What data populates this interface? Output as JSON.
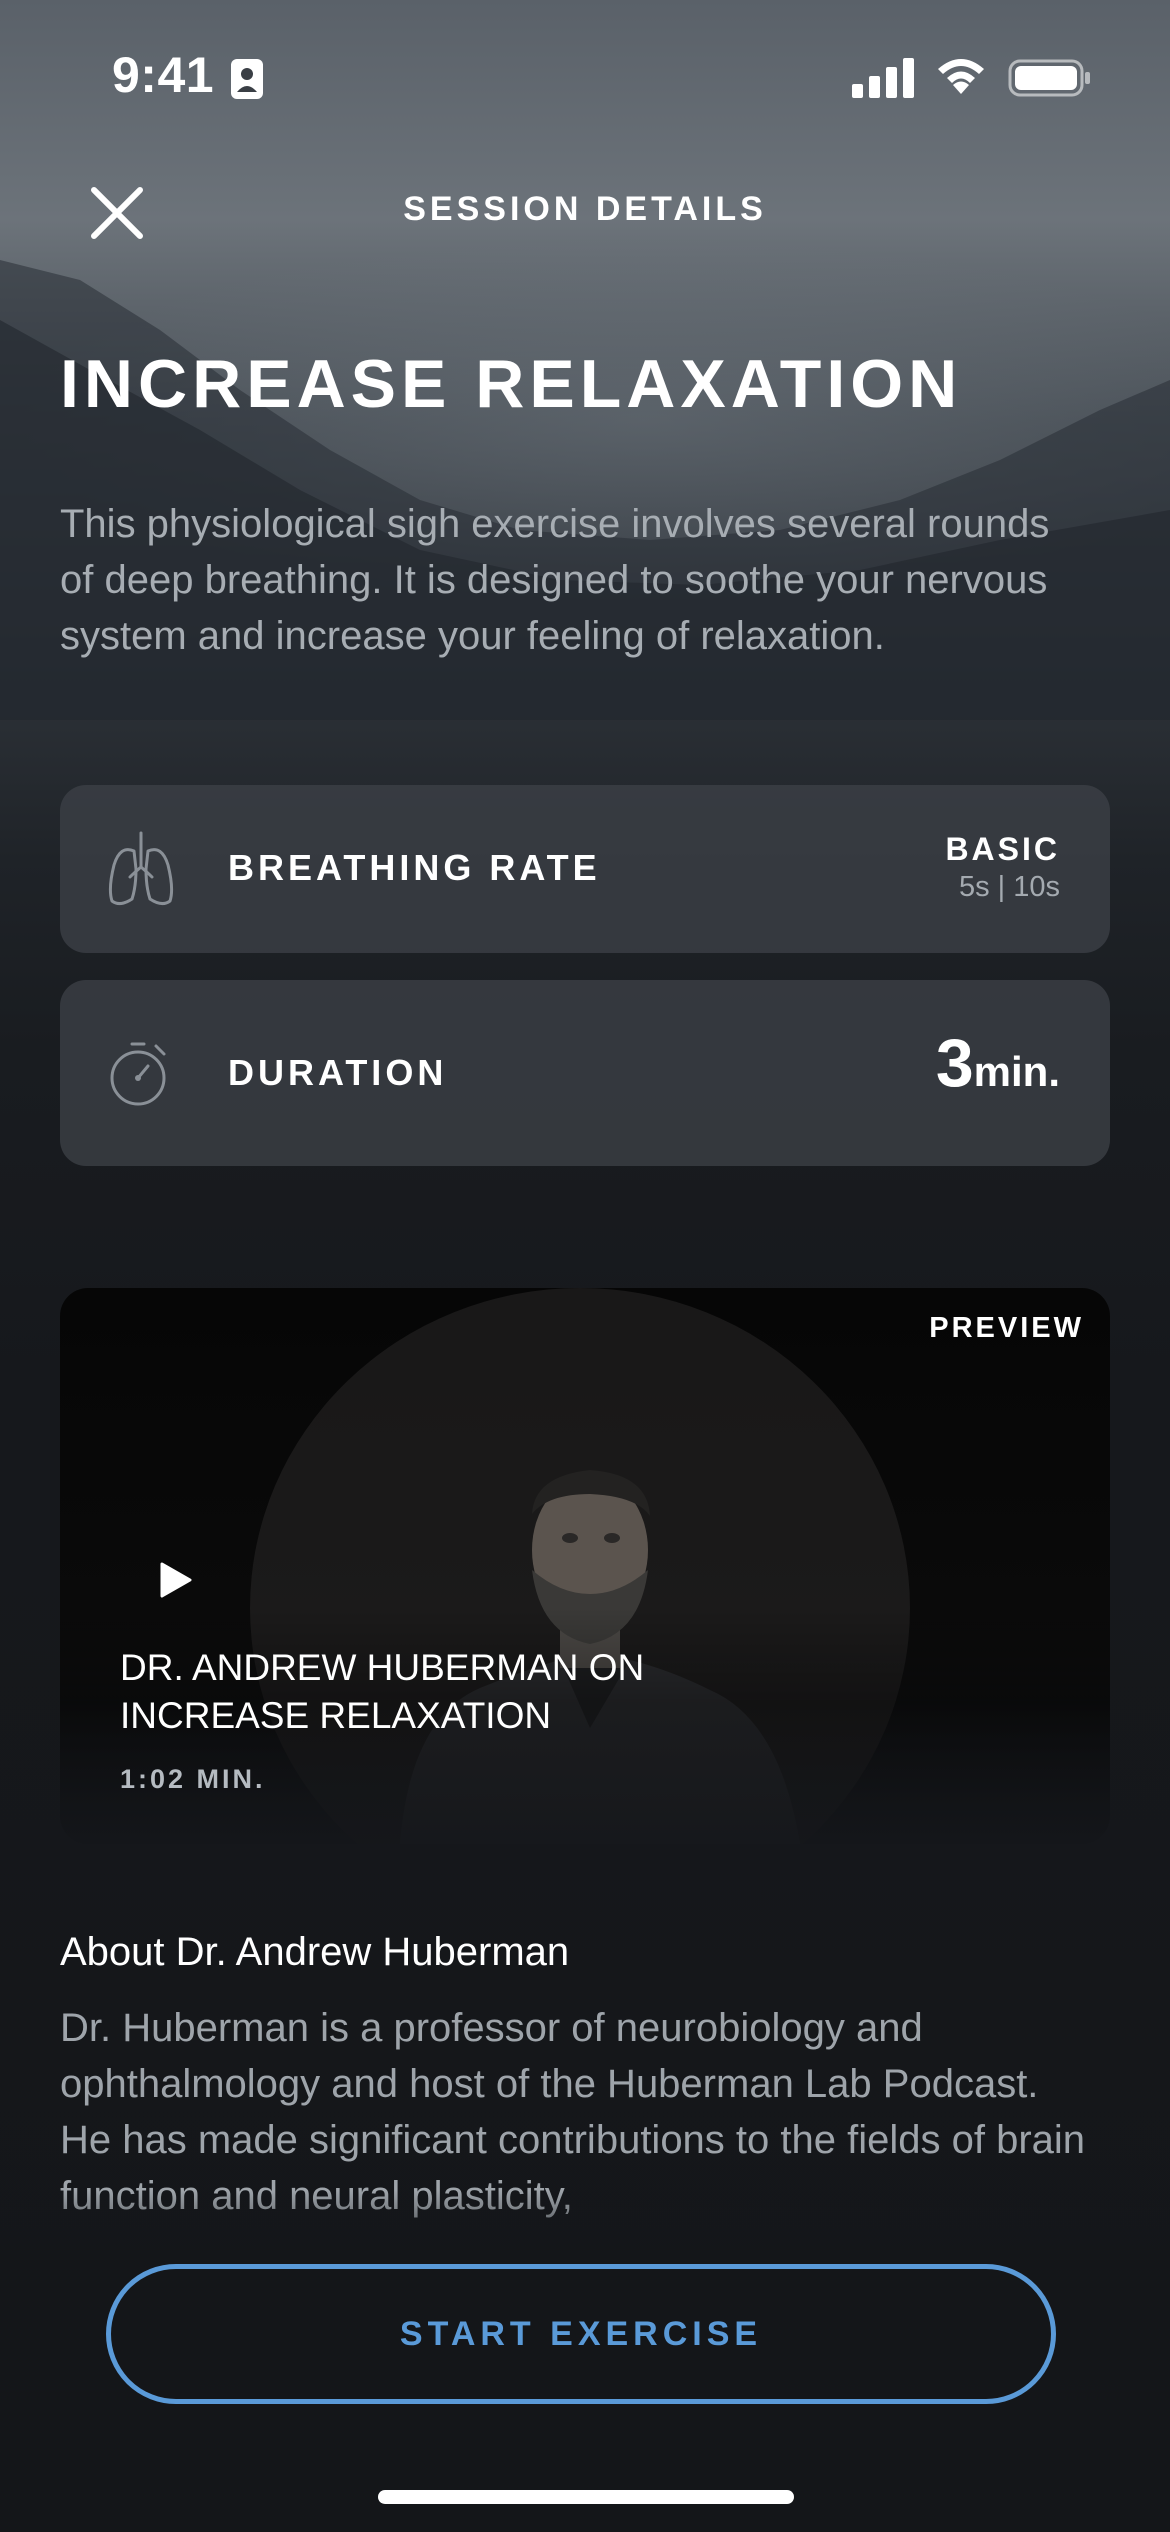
{
  "status_bar": {
    "time": "9:41"
  },
  "header": {
    "title": "SESSION DETAILS"
  },
  "session": {
    "title": "INCREASE RELAXATION",
    "description": "This physiological sigh exercise involves several rounds of deep breathing. It is designed to soothe your nervous system and increase your feeling of relaxation."
  },
  "stats": {
    "breathing": {
      "label": "BREATHING RATE",
      "value": "BASIC",
      "sub_value": "5s | 10s",
      "icon": "lungs-icon"
    },
    "duration": {
      "label": "DURATION",
      "number": "3",
      "unit": "min.",
      "icon": "stopwatch-icon"
    }
  },
  "video": {
    "badge": "PREVIEW",
    "title": "DR. ANDREW HUBERMAN ON INCREASE RELAXATION",
    "length": "1:02 MIN.",
    "play_icon": "play-icon"
  },
  "about": {
    "heading": "About Dr. Andrew Huberman",
    "body": "Dr. Huberman is a professor of neurobiology and ophthalmology and host of the Huberman Lab Podcast. He has made significant contributions to the fields of brain function and neural plasticity,"
  },
  "cta": {
    "label": "START EXERCISE"
  },
  "colors": {
    "accent": "#5a9ad8",
    "card_background": "#3c4046",
    "muted_text": "#a7adb3"
  }
}
